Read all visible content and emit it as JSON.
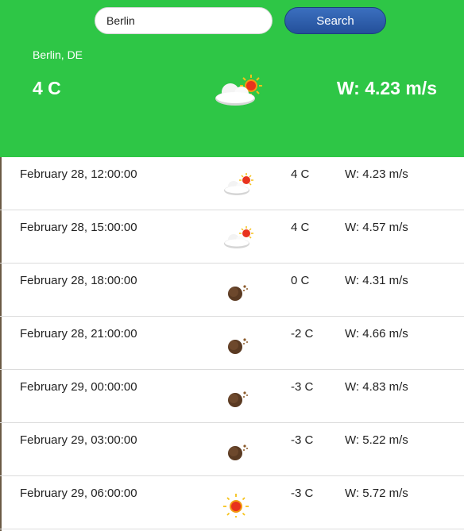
{
  "search": {
    "value": "Berlin",
    "button_label": "Search"
  },
  "current": {
    "city": "Berlin, DE",
    "temp": "4 C",
    "wind": "W: 4.23 m/s",
    "icon": "cloud-sun-icon"
  },
  "forecast": [
    {
      "date": "February 28, 12:00:00",
      "icon": "cloud-sun-icon",
      "temp": "4 C",
      "wind": "W: 4.23 m/s"
    },
    {
      "date": "February 28, 15:00:00",
      "icon": "cloud-sun-icon",
      "temp": "4 C",
      "wind": "W: 4.57 m/s"
    },
    {
      "date": "February 28, 18:00:00",
      "icon": "moon-icon",
      "temp": "0 C",
      "wind": "W: 4.31 m/s"
    },
    {
      "date": "February 28, 21:00:00",
      "icon": "moon-icon",
      "temp": "-2 C",
      "wind": "W: 4.66 m/s"
    },
    {
      "date": "February 29, 00:00:00",
      "icon": "moon-icon",
      "temp": "-3 C",
      "wind": "W: 4.83 m/s"
    },
    {
      "date": "February 29, 03:00:00",
      "icon": "moon-icon",
      "temp": "-3 C",
      "wind": "W: 5.22 m/s"
    },
    {
      "date": "February 29, 06:00:00",
      "icon": "sun-icon",
      "temp": "-3 C",
      "wind": "W: 5.72 m/s"
    }
  ],
  "colors": {
    "header_bg": "#2ec646",
    "button_bg": "#24509a",
    "divider": "#dcdcdc"
  }
}
